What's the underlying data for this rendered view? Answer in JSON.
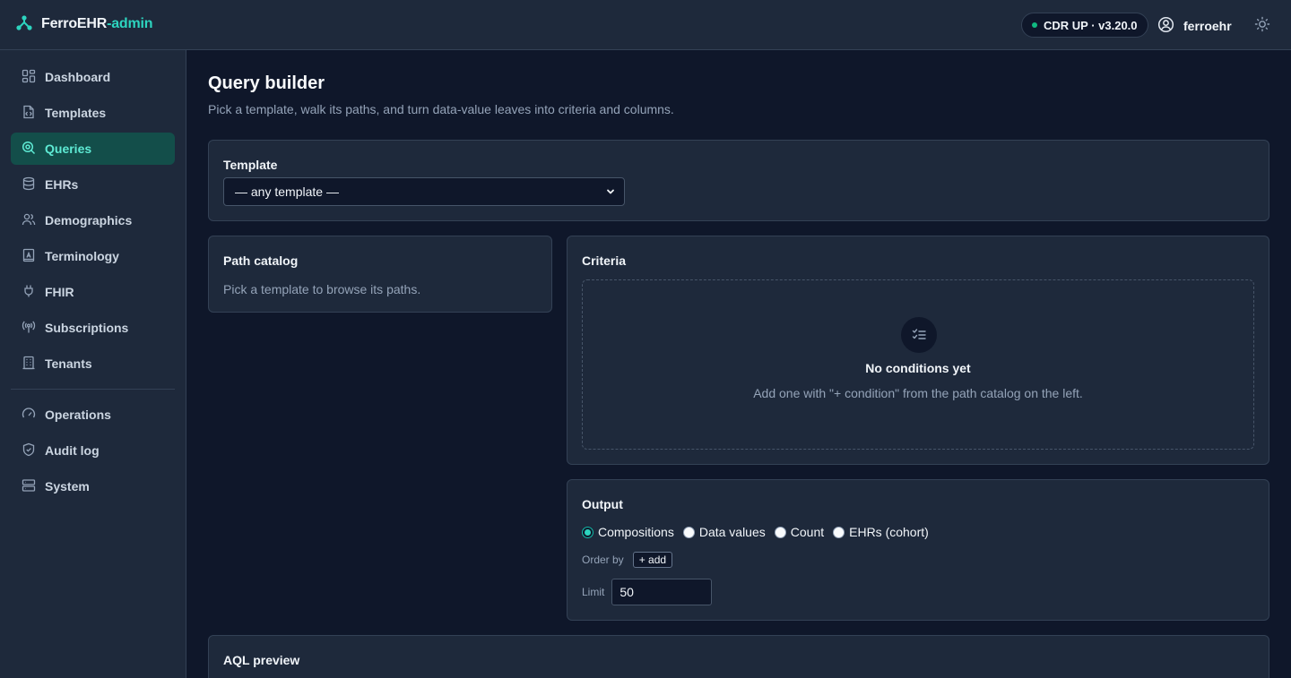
{
  "header": {
    "brand_main": "FerroEHR",
    "brand_accent": "-admin",
    "status": "CDR UP · v3.20.0",
    "username": "ferroehr"
  },
  "colors": {
    "accent": "#2dd4bf",
    "active_bg": "#134e4a",
    "status_ok": "#10b981",
    "background": "#0f172a",
    "panel": "#1e293b"
  },
  "sidebar": {
    "items": [
      {
        "label": "Dashboard",
        "icon": "dashboard-icon",
        "active": false
      },
      {
        "label": "Templates",
        "icon": "template-icon",
        "active": false
      },
      {
        "label": "Queries",
        "icon": "query-icon",
        "active": true
      },
      {
        "label": "EHRs",
        "icon": "database-icon",
        "active": false
      },
      {
        "label": "Demographics",
        "icon": "users-icon",
        "active": false
      },
      {
        "label": "Terminology",
        "icon": "book-icon",
        "active": false
      },
      {
        "label": "FHIR",
        "icon": "plug-icon",
        "active": false
      },
      {
        "label": "Subscriptions",
        "icon": "broadcast-icon",
        "active": false
      },
      {
        "label": "Tenants",
        "icon": "building-icon",
        "active": false
      }
    ],
    "secondary_items": [
      {
        "label": "Operations",
        "icon": "gauge-icon"
      },
      {
        "label": "Audit log",
        "icon": "shield-icon"
      },
      {
        "label": "System",
        "icon": "server-icon"
      }
    ]
  },
  "page": {
    "title": "Query builder",
    "subtitle": "Pick a template, walk its paths, and turn data-value leaves into criteria and columns."
  },
  "template_card": {
    "label": "Template",
    "selected": "— any template —"
  },
  "path_catalog": {
    "title": "Path catalog",
    "hint": "Pick a template to browse its paths."
  },
  "criteria": {
    "title": "Criteria",
    "empty_title": "No conditions yet",
    "empty_text": "Add one with \"+ condition\" from the path catalog on the left."
  },
  "output": {
    "title": "Output",
    "options": [
      "Compositions",
      "Data values",
      "Count",
      "EHRs (cohort)"
    ],
    "selected": "Compositions",
    "order_by_label": "Order by",
    "add_label": "+ add",
    "limit_label": "Limit",
    "limit_value": "50"
  },
  "aql_preview": {
    "title": "AQL preview"
  }
}
